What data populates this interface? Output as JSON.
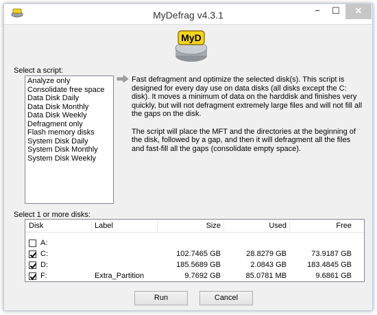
{
  "window": {
    "title": "MyDefrag v4.3.1",
    "minimize": "−",
    "maximize": "☐",
    "close": "✕"
  },
  "logo": {
    "text": "MyD",
    "accent": "#f7d51d",
    "disk_color": "#b8bcc2"
  },
  "scripts": {
    "label": "Select a script:",
    "items": [
      "Analyze only",
      "Consolidate free space",
      "Data Disk Daily",
      "Data Disk Monthly",
      "Data Disk Weekly",
      "Defragment only",
      "Flash memory disks",
      "System Disk Daily",
      "System Disk Monthly",
      "System Disk Weekly"
    ]
  },
  "description": {
    "p1": "Fast defragment and optimize the selected disk(s). This script is designed for every day use on data disks (all disks except the C: disk). It moves a minimum of data on the harddisk and finishes very quickly, but will not defragment  extremely large files and will not fill all the gaps on the disk.",
    "p2": "The script will place the MFT and the directories at the beginning of the disk, followed by a gap, and then it will defragment all the files and fast-fill all the gaps (consolidate empty space)."
  },
  "disks": {
    "label": "Select 1 or more disks:",
    "headers": {
      "disk": "Disk",
      "label": "Label",
      "size": "Size",
      "used": "Used",
      "free": "Free"
    },
    "rows": [
      {
        "disk": "A:",
        "label": "",
        "size": "",
        "used": "",
        "free": "",
        "checked": false
      },
      {
        "disk": "C:",
        "label": "",
        "size": "102.7465 GB",
        "used": "28.8279 GB",
        "free": "73.9187 GB",
        "checked": true
      },
      {
        "disk": "D:",
        "label": "",
        "size": "185.5689 GB",
        "used": "2.0843 GB",
        "free": "183.4845 GB",
        "checked": true
      },
      {
        "disk": "F:",
        "label": "Extra_Partition",
        "size": "9.7692 GB",
        "used": "85.0781 MB",
        "free": "9.6861 GB",
        "checked": true
      }
    ]
  },
  "buttons": {
    "run": "Run",
    "cancel": "Cancel"
  }
}
